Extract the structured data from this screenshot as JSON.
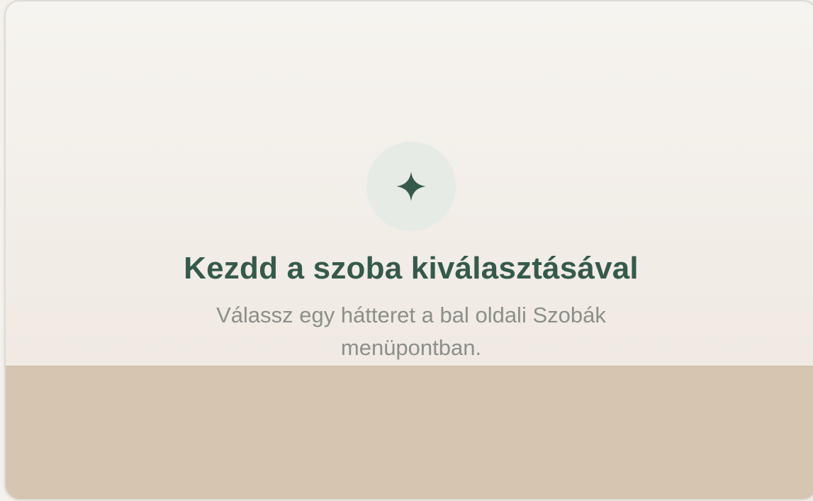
{
  "empty_state": {
    "icon": "sparkle-icon",
    "title": "Kezdd a szoba kiválasztásával",
    "subtitle": "Válassz egy hátteret a bal oldali Szobák menüpontban."
  },
  "colors": {
    "accent": "#355a4b",
    "icon_bg": "#e6ebe6",
    "subtitle": "#8a8f88",
    "floor": "#d5c5b1",
    "wall": "#f2ede7"
  }
}
